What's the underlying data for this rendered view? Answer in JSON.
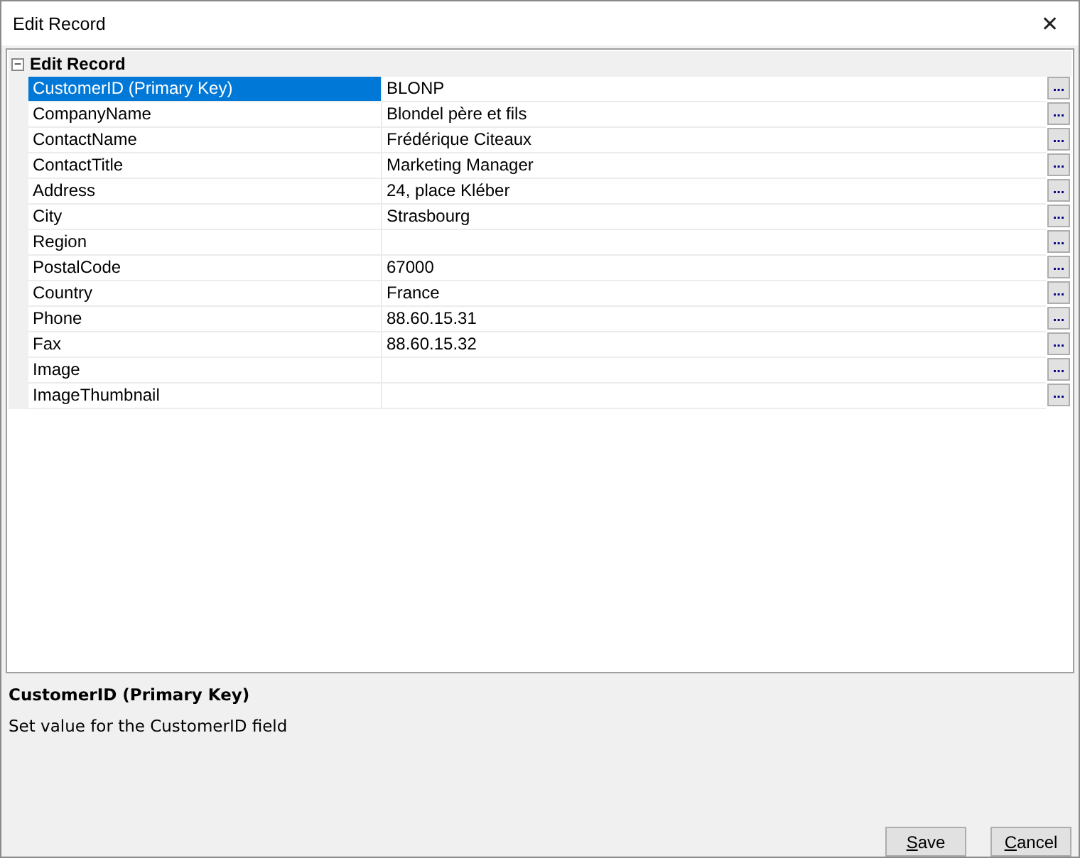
{
  "window": {
    "title": "Edit Record",
    "close": "✕"
  },
  "grid": {
    "category": {
      "label": "Edit Record",
      "expanded": true,
      "toggle": "−"
    },
    "properties": [
      {
        "name": "CustomerID (Primary Key)",
        "value": "BLONP",
        "selected": true,
        "button": "..."
      },
      {
        "name": "CompanyName",
        "value": "Blondel père et fils",
        "selected": false,
        "button": "..."
      },
      {
        "name": "ContactName",
        "value": "Frédérique Citeaux",
        "selected": false,
        "button": "..."
      },
      {
        "name": "ContactTitle",
        "value": "Marketing Manager",
        "selected": false,
        "button": "..."
      },
      {
        "name": "Address",
        "value": "24, place Kléber",
        "selected": false,
        "button": "..."
      },
      {
        "name": "City",
        "value": "Strasbourg",
        "selected": false,
        "button": "..."
      },
      {
        "name": "Region",
        "selected": false,
        "button": "..."
      },
      {
        "name": "PostalCode",
        "value": "67000",
        "selected": false,
        "button": "..."
      },
      {
        "name": "Country",
        "value": "France",
        "selected": false,
        "button": "..."
      },
      {
        "name": "Phone",
        "value": "88.60.15.31",
        "selected": false,
        "button": "..."
      },
      {
        "name": "Fax",
        "value": "88.60.15.32",
        "selected": false,
        "button": "..."
      },
      {
        "name": "Image",
        "selected": false,
        "button": "..."
      },
      {
        "name": "ImageThumbnail",
        "selected": false,
        "button": "..."
      }
    ]
  },
  "description": {
    "title": "CustomerID (Primary Key)",
    "text": "Set value for the CustomerID field"
  },
  "buttons": [
    "Save",
    "Cancel"
  ]
}
